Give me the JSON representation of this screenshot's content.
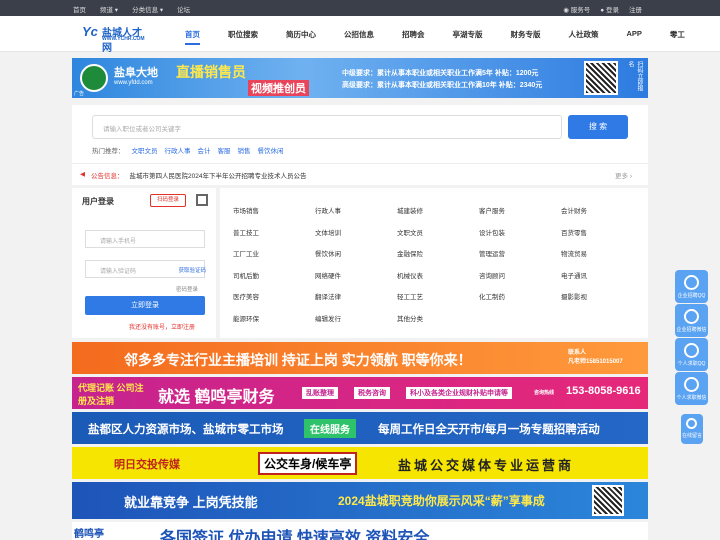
{
  "topbar": {
    "left": [
      "首页",
      "频道 ▾",
      "分类信息 ▾",
      "论坛"
    ],
    "service": "服务号",
    "login": "登录",
    "register": "注册"
  },
  "logo": {
    "mark": "Yc",
    "title": "盐城人才网",
    "sub": "WWW.YCHR.COM"
  },
  "nav": [
    "首页",
    "职位搜索",
    "简历中心",
    "公招信息",
    "招聘会",
    "亭湖专版",
    "财务专版",
    "人社政策",
    "APP",
    "零工"
  ],
  "banner1": {
    "name": "盐阜大地",
    "url": "www.yfdd.com",
    "headline": "直播销售员",
    "sub": "视频推创员",
    "req1": "中级要求：累计从事本职业或相关职业工作满5年  补贴：1200元",
    "req2": "高级要求：累计从事本职业或相关职业工作满10年 补贴：2340元",
    "side": "扫码立即报名",
    "ad": "广告"
  },
  "search": {
    "placeholder": "请输入职位或者公司关键字",
    "button": "搜 索",
    "hot_label": "热门推荐：",
    "hot": [
      "文职文员",
      "行政人事",
      "会计",
      "客服",
      "销售",
      "餐饮休闲"
    ]
  },
  "notice": {
    "label": "公告信息：",
    "text": "盐城市第四人民医院2024年下半年公开招聘专业技术人员公告",
    "more": "更多 ›"
  },
  "login": {
    "title": "用户登录",
    "scan": "扫码登录",
    "phone": "请输入手机号",
    "code": "请输入验证码",
    "get_code": "获取验证码",
    "pw_login": "密码登录",
    "submit": "立即登录",
    "register": "我还没有账号，立即注册"
  },
  "categories": [
    "市场销售",
    "行政人事",
    "城建装修",
    "客户服务",
    "会计财务",
    "普工技工",
    "文体培训",
    "文职文员",
    "设计包装",
    "百货零售",
    "工厂工业",
    "餐饮休闲",
    "金融保险",
    "管理运营",
    "物流贸易",
    "司机后勤",
    "网络硬件",
    "机械仪表",
    "咨询顾问",
    "电子通讯",
    "医疗美容",
    "翻译法律",
    "轻工工艺",
    "化工制药",
    "摄影影视",
    "能源环保",
    "编辑发行",
    "其他分类"
  ],
  "ads": {
    "a1": "邻多多专注行业主播培训   持证上岗   实力领航   职等你来！",
    "a1b": "联系人\n凡老师15851015007",
    "a2": "代理记账 公司注册及注销",
    "a2b": "就选 鹤鸣亭财务",
    "a2c": [
      "乱账整理",
      "税务咨询",
      "科小及各类企业规财补贴申请等"
    ],
    "a2d": "153-8058-9616",
    "a2e": "咨询热线",
    "a3": "盐都区人力资源市场、盐城市零工市场",
    "a3b": "在线服务",
    "a3c": "每周工作日全天开市/每月一场专题招聘活动",
    "a4": "明日交投传媒",
    "a4b": "公交车身/候车亭",
    "a4c": "盐城公交媒体专业运营商",
    "a5": "就业靠竞争 上岗凭技能",
    "a5b": "2024盐城职竞助你展示风采“薪”享事成",
    "a6": "鹤鸣亭",
    "a6b": "各国签证  优办申请     快速高效  资料安全"
  },
  "float": [
    "企业招聘QQ",
    "企业招聘微信",
    "个人求职QQ",
    "个人求职微信",
    "在线留言"
  ],
  "colors": {
    "brand": "#2b6de0",
    "accent": "#e2312d"
  }
}
